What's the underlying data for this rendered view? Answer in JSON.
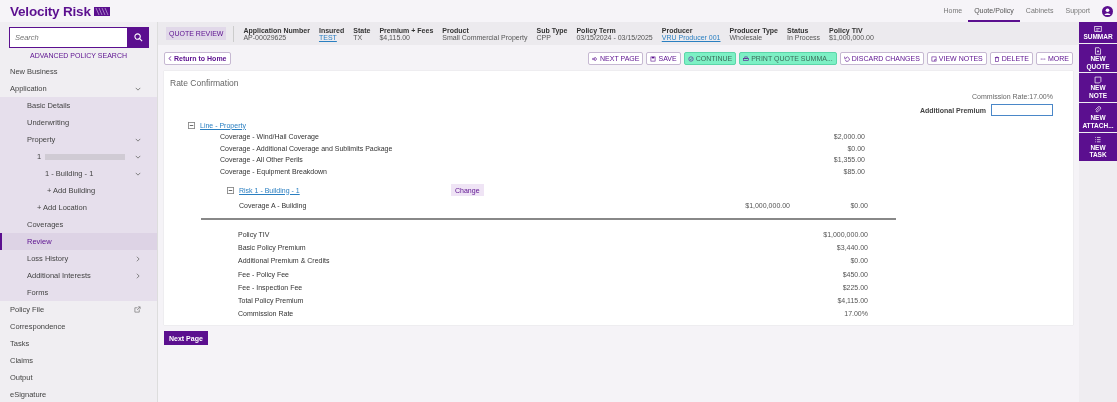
{
  "top_bar": {
    "logo": "Velocity Risk",
    "nav": [
      {
        "label": "Home",
        "selected": false
      },
      {
        "label": "Quote/Policy",
        "selected": true
      },
      {
        "label": "Cabinets",
        "selected": false
      },
      {
        "label": "Support",
        "selected": false
      }
    ]
  },
  "sidebar": {
    "search": {
      "placeholder": "Search"
    },
    "advanced_search": "ADVANCED POLICY SEARCH",
    "items": [
      {
        "label": "New Business",
        "selected": false
      },
      {
        "label": "Application",
        "selected": false,
        "expanded": true,
        "children": [
          {
            "label": "Basic Details",
            "selected": false
          },
          {
            "label": "Underwriting",
            "selected": false
          },
          {
            "label": "Property",
            "selected": false,
            "expanded": true,
            "children": [
              {
                "label": "1",
                "redacted": true,
                "selected": false,
                "expanded": true,
                "children": [
                  {
                    "label": "1 - Building - 1",
                    "selected": false,
                    "expanded": true,
                    "children": [
                      {
                        "label": "+ Add Building",
                        "selected": false
                      }
                    ]
                  }
                ]
              },
              {
                "label": "+ Add Location",
                "selected": false
              }
            ]
          },
          {
            "label": "Coverages",
            "selected": false
          },
          {
            "label": "Review",
            "selected": true
          },
          {
            "label": "Loss History",
            "selected": false,
            "expanded": false
          },
          {
            "label": "Additional Interests",
            "selected": false,
            "expanded": false
          },
          {
            "label": "Forms",
            "selected": false
          }
        ]
      },
      {
        "label": "Policy File",
        "selected": false,
        "external": true
      },
      {
        "label": "Correspondence",
        "selected": false
      },
      {
        "label": "Tasks",
        "selected": false
      },
      {
        "label": "Claims",
        "selected": false
      },
      {
        "label": "Output",
        "selected": false
      },
      {
        "label": "eSignature",
        "selected": false
      }
    ]
  },
  "header": {
    "badge": "QUOTE REVIEW",
    "fields": [
      {
        "label": "Application Number",
        "value": "AP-00029625",
        "kind": "text"
      },
      {
        "label": "Insured",
        "value": "TEST",
        "kind": "link"
      },
      {
        "label": "State",
        "value": "TX",
        "kind": "text"
      },
      {
        "label": "Premium + Fees",
        "value": "$4,115.00",
        "kind": "text"
      },
      {
        "label": "Product",
        "value": "Small Commercial Property",
        "kind": "text"
      },
      {
        "label": "Sub Type",
        "value": "CPP",
        "kind": "text"
      },
      {
        "label": "Policy Term",
        "value": "03/15/2024 - 03/15/2025",
        "kind": "text"
      },
      {
        "label": "Producer",
        "value": "VRU Producer 001",
        "kind": "link"
      },
      {
        "label": "Producer Type",
        "value": "Wholesale",
        "kind": "text"
      },
      {
        "label": "Status",
        "value": "In Process",
        "kind": "text"
      },
      {
        "label": "Policy TIV",
        "value": "$1,000,000.00",
        "kind": "text"
      }
    ]
  },
  "return_button": "Return to Home",
  "toolbar": [
    {
      "label": "NEXT PAGE",
      "kind": "default"
    },
    {
      "label": "SAVE",
      "kind": "default"
    },
    {
      "label": "CONTINUE",
      "kind": "highlight"
    },
    {
      "label": "PRINT QUOTE SUMMA...",
      "kind": "highlight"
    },
    {
      "label": "DISCARD CHANGES",
      "kind": "default"
    },
    {
      "label": "VIEW NOTES",
      "kind": "default"
    },
    {
      "label": "DELETE",
      "kind": "default"
    },
    {
      "label": "MORE",
      "kind": "default"
    }
  ],
  "card": {
    "title": "Rate Confirmation",
    "commission_rate": "Commission Rate:17.00%",
    "additional_premium": {
      "label": "Additional Premium"
    },
    "line": {
      "label": "Line - Property",
      "expanded": true,
      "coverages": [
        {
          "name": "Coverage - Wind/Hail Coverage",
          "premium": "$2,000.00"
        },
        {
          "name": "Coverage - Additional Coverage and Sublimits Package",
          "premium": "$0.00"
        },
        {
          "name": "Coverage - All Other Perils",
          "premium": "$1,355.00"
        },
        {
          "name": "Coverage - Equipment Breakdown",
          "premium": "$85.00"
        }
      ]
    },
    "risk": {
      "label": "Risk 1 - Building - 1",
      "expanded": true,
      "change_button": "Change",
      "coverages": [
        {
          "name": "Coverage A - Building",
          "limit": "$1,000,000.00",
          "premium": "$0.00"
        }
      ]
    },
    "summary": [
      {
        "label": "Policy TIV",
        "value": "$1,000,000.00"
      },
      {
        "label": "Basic Policy Premium",
        "value": "$3,440.00"
      },
      {
        "label": "Additional Premium & Credits",
        "value": "$0.00"
      },
      {
        "label": "Fee - Policy Fee",
        "value": "$450.00"
      },
      {
        "label": "Fee - Inspection Fee",
        "value": "$225.00"
      },
      {
        "label": "Total Policy Premium",
        "value": "$4,115.00"
      },
      {
        "label": "Commission Rate",
        "value": "17.00%"
      }
    ]
  },
  "next_button": "Next Page",
  "right_rail": [
    {
      "label": "SUMMAR"
    },
    {
      "label": "NEW QUOTE"
    },
    {
      "label": "NEW NOTE"
    },
    {
      "label": "NEW ATTACH..."
    },
    {
      "label": "NEW TASK"
    }
  ]
}
